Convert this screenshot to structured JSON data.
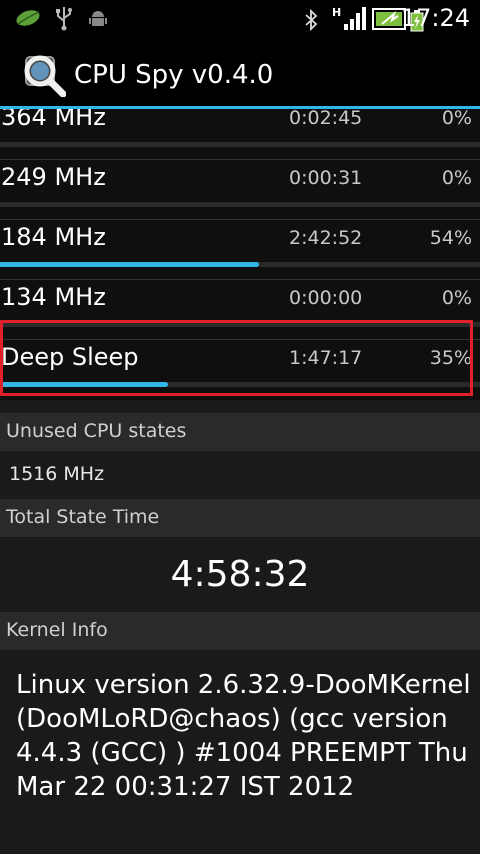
{
  "status_bar": {
    "time": "17:24",
    "icons": [
      "leaf-notification-icon",
      "usb-icon",
      "android-debug-icon",
      "bluetooth-icon",
      "signal-h-icon",
      "wifi-icon",
      "battery-charging-icon"
    ]
  },
  "app": {
    "title": "CPU Spy v0.4.0",
    "icon": "magnifier-chip-icon",
    "accent": "#33b5e5"
  },
  "states": [
    {
      "freq": "364 MHz",
      "time": "0:02:45",
      "percent": "0%",
      "fraction": 0.0
    },
    {
      "freq": "249 MHz",
      "time": "0:00:31",
      "percent": "0%",
      "fraction": 0.0
    },
    {
      "freq": "184 MHz",
      "time": "2:42:52",
      "percent": "54%",
      "fraction": 0.54
    },
    {
      "freq": "134 MHz",
      "time": "0:00:00",
      "percent": "0%",
      "fraction": 0.0
    },
    {
      "freq": "Deep Sleep",
      "time": "1:47:17",
      "percent": "35%",
      "fraction": 0.35
    }
  ],
  "unused": {
    "header": "Unused CPU states",
    "value": "1516 MHz"
  },
  "total": {
    "header": "Total State Time",
    "value": "4:58:32"
  },
  "kernel": {
    "header": "Kernel Info",
    "text": "Linux version 2.6.32.9-DooMKernel (DooMLoRD@chaos) (gcc version 4.4.3 (GCC) ) #1004 PREEMPT Thu Mar 22 00:31:27 IST 2012"
  },
  "highlight_color": "#e0202a"
}
